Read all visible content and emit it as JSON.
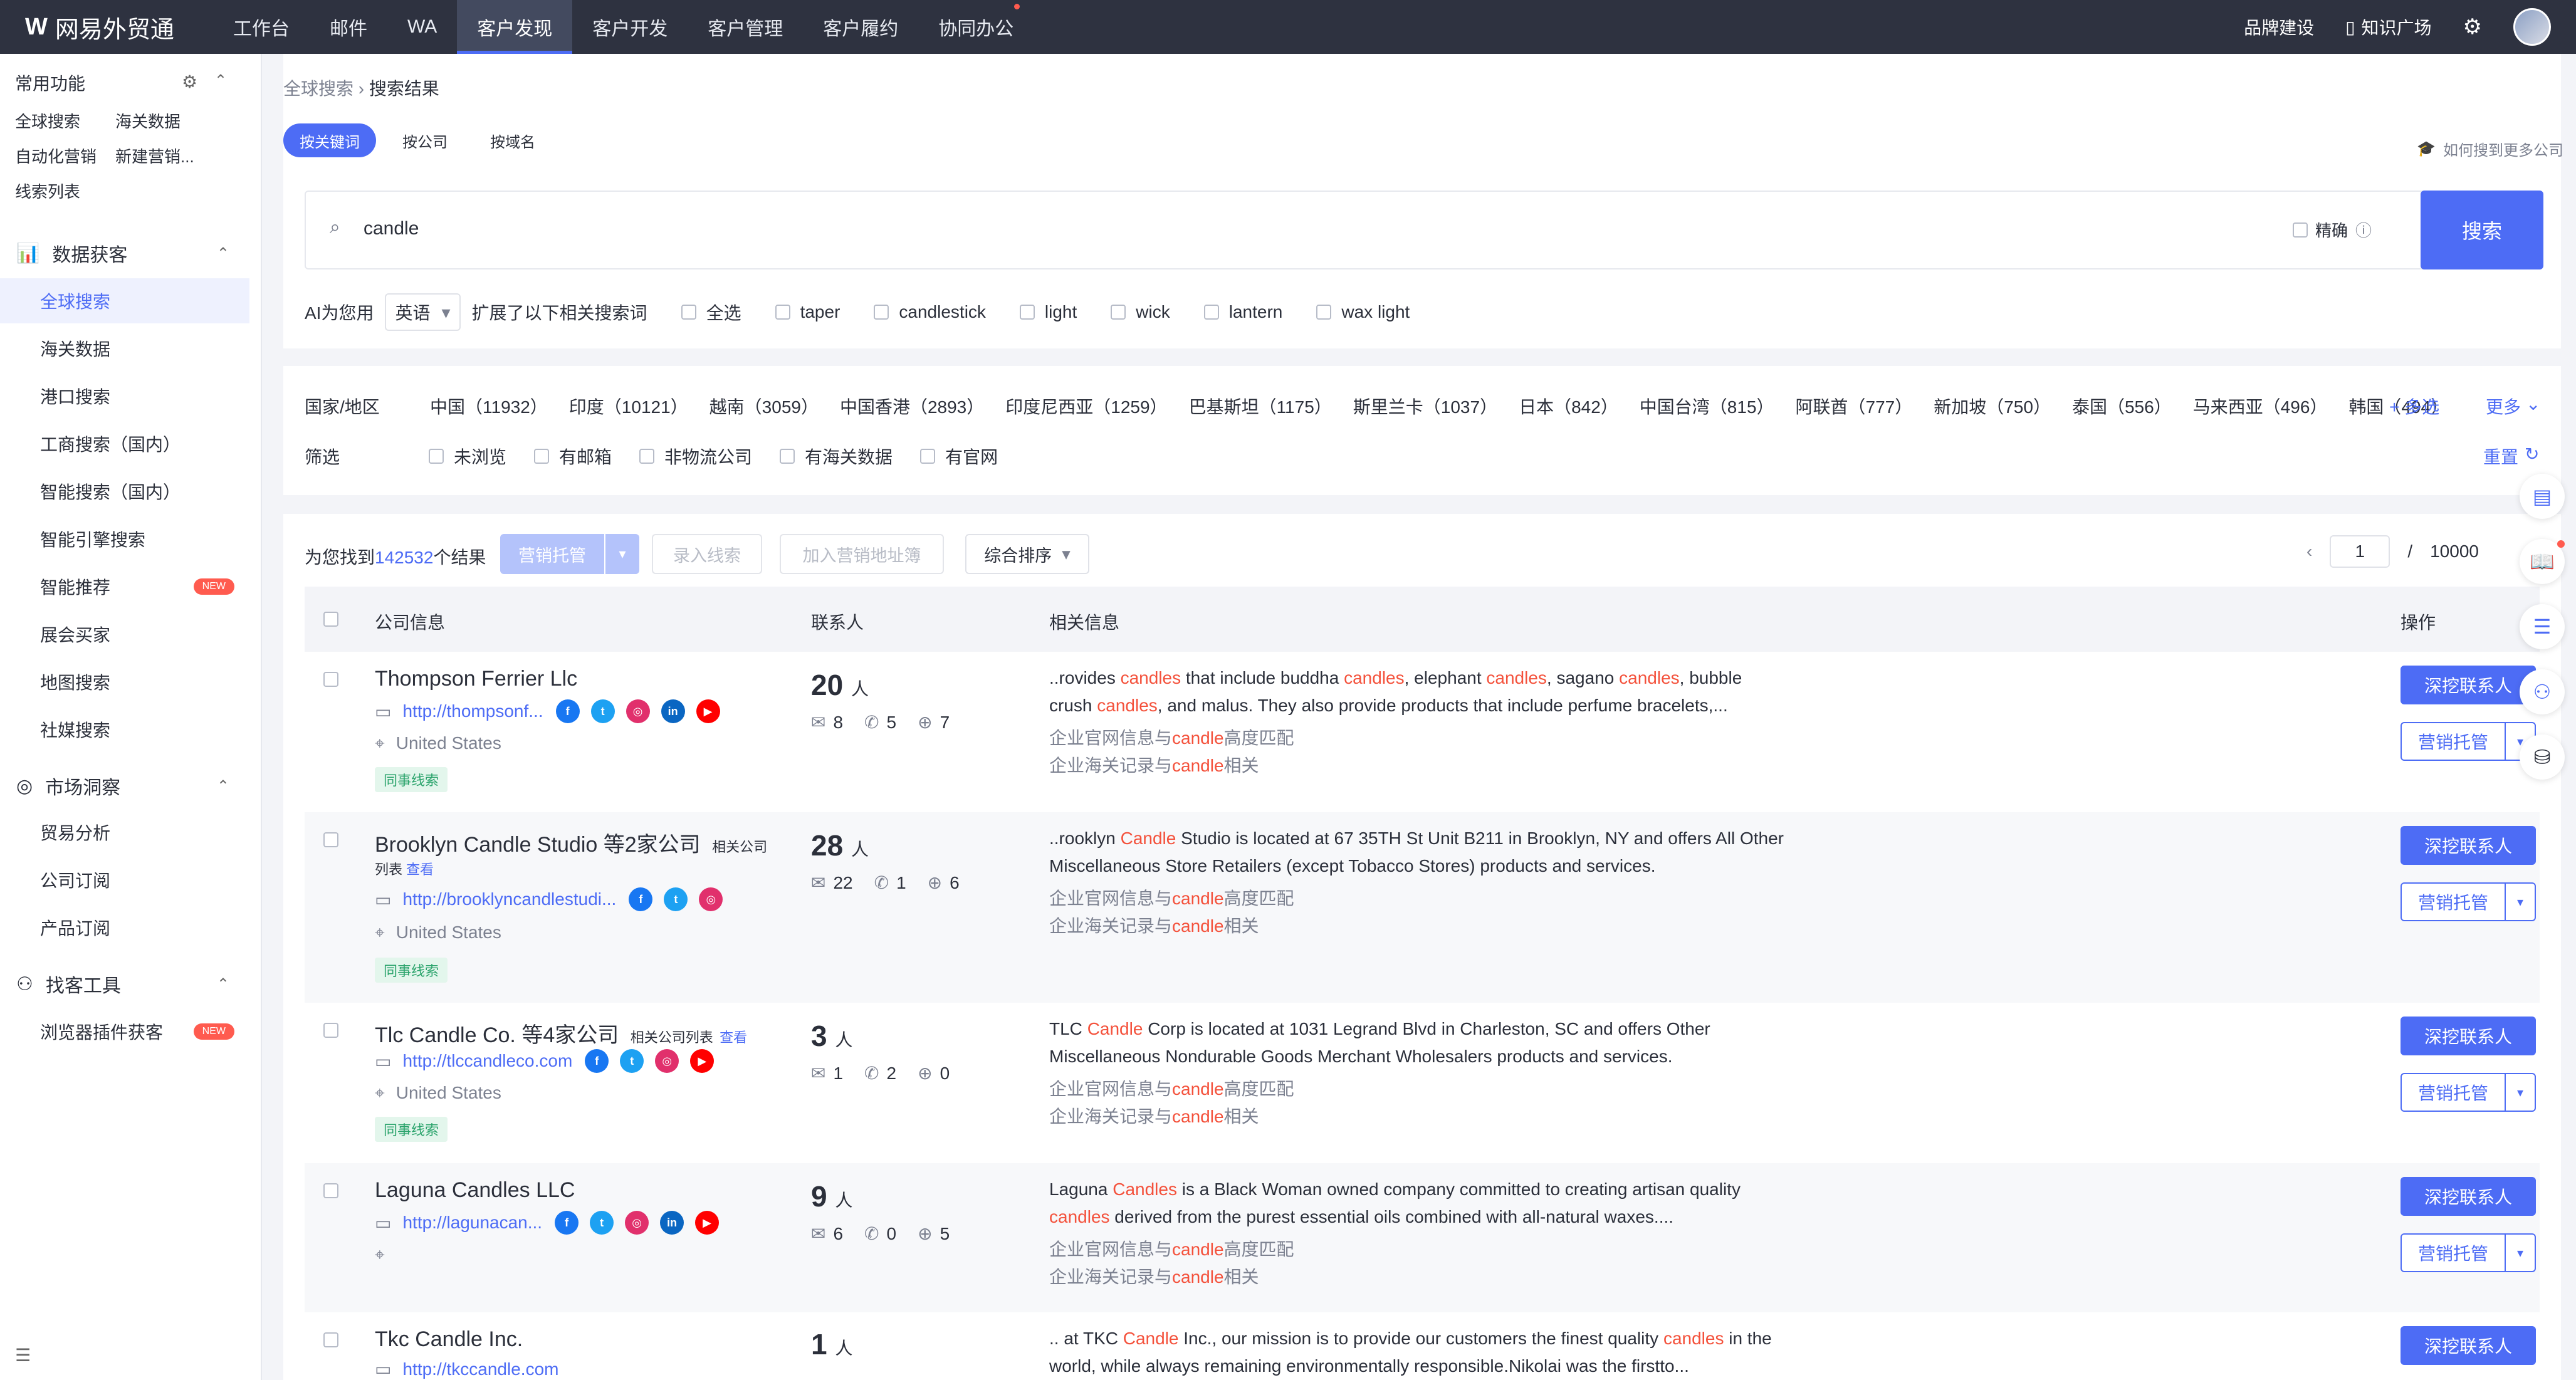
{
  "app": {
    "logo_mark": "W",
    "name": "网易外贸通"
  },
  "topnav": [
    "工作台",
    "邮件",
    "WA",
    "客户发现",
    "客户开发",
    "客户管理",
    "客户履约",
    "协同办公"
  ],
  "topright": {
    "brand": "品牌建设",
    "knowledge": "知识广场"
  },
  "sidebar": {
    "common_title": "常用功能",
    "common_links": [
      "全球搜索",
      "海关数据",
      "自动化营销",
      "新建营销...",
      "线索列表"
    ],
    "section_data": "数据获客",
    "data_items": [
      "全球搜索",
      "海关数据",
      "港口搜索",
      "工商搜索（国内）",
      "智能搜索（国内）",
      "智能引擎搜索",
      "智能推荐",
      "展会买家",
      "地图搜索",
      "社媒搜索"
    ],
    "section_market": "市场洞察",
    "market_items": [
      "贸易分析",
      "公司订阅",
      "产品订阅"
    ],
    "section_tools": "找客工具",
    "tool_items": [
      "浏览器插件获客"
    ],
    "new_badge": "NEW"
  },
  "breadcrumb": {
    "root": "全球搜索",
    "current": "搜索结果"
  },
  "search_tabs": [
    "按关键词",
    "按公司",
    "按域名"
  ],
  "help_link": "如何搜到更多公司",
  "search": {
    "value": "candle",
    "exact_label": "精确",
    "button": "搜索"
  },
  "ai": {
    "prefix": "AI为您用",
    "language": "英语",
    "suffix": "扩展了以下相关搜索词",
    "select_all": "全选",
    "terms": [
      "taper",
      "candlestick",
      "light",
      "wick",
      "lantern",
      "wax light"
    ]
  },
  "filters": {
    "country_label": "国家/地区",
    "countries": [
      "中国（11932）",
      "印度（10121）",
      "越南（3059）",
      "中国香港（2893）",
      "印度尼西亚（1259）",
      "巴基斯坦（1175）",
      "斯里兰卡（1037）",
      "日本（842）",
      "中国台湾（815）",
      "阿联酋（777）",
      "新加坡（750）",
      "泰国（556）",
      "马来西亚（496）",
      "韩国（494）"
    ],
    "multi": "+ 多选",
    "more": "更多",
    "filter_label": "筛选",
    "filter_opts": [
      "未浏览",
      "有邮箱",
      "非物流公司",
      "有海关数据",
      "有官网"
    ],
    "reset": "重置"
  },
  "results": {
    "found_prefix": "为您找到",
    "count": "142532",
    "found_suffix": "个结果",
    "btn_marketing": "营销托管",
    "btn_lead": "录入线索",
    "btn_address": "加入营销地址簿",
    "sort": "综合排序",
    "page": "1",
    "page_sep": "/",
    "total_pages": "10000"
  },
  "table_headers": {
    "company": "公司信息",
    "contacts": "联系人",
    "info": "相关信息",
    "action": "操作"
  },
  "actions": {
    "deep": "深挖联系人",
    "market": "营销托管"
  },
  "rows": [
    {
      "name": "Thompson Ferrier Llc",
      "related": "",
      "related_2": "",
      "related_link": "",
      "url": "http://thompsonf...",
      "country": "United States",
      "tag": "同事线索",
      "people": "20",
      "unit": "人",
      "mail": "8",
      "wa": "5",
      "web": "7",
      "desc": [
        {
          "t": "..rovides ",
          "h": false
        },
        {
          "t": "candles",
          "h": true
        },
        {
          "t": " that include buddha ",
          "h": false
        },
        {
          "t": "candles",
          "h": true
        },
        {
          "t": ", elephant ",
          "h": false
        },
        {
          "t": "candles",
          "h": true
        },
        {
          "t": ", sagano ",
          "h": false
        },
        {
          "t": "candles",
          "h": true
        },
        {
          "t": ", bubble crush ",
          "h": false
        },
        {
          "t": "candles",
          "h": true
        },
        {
          "t": ", and malus. They also provide products that include perfume bracelets,...",
          "h": false
        }
      ],
      "m1": [
        "企业官网信息与",
        "candle",
        "高度匹配"
      ],
      "m2": [
        "企业海关记录与",
        "candle",
        "相关"
      ]
    },
    {
      "name": "Brooklyn Candle Studio 等2家公司",
      "related": "相关公司",
      "related_2": "列表",
      "related_link": "查看",
      "url": "http://brooklyncandlestudi...",
      "country": "United States",
      "tag": "同事线索",
      "people": "28",
      "unit": "人",
      "mail": "22",
      "wa": "1",
      "web": "6",
      "desc": [
        {
          "t": "..rooklyn ",
          "h": false
        },
        {
          "t": "Candle",
          "h": true
        },
        {
          "t": " Studio is located at 67 35TH St Unit B211 in Brooklyn, NY and offers All Other Miscellaneous Store Retailers (except Tobacco Stores) products and services.",
          "h": false
        }
      ],
      "m1": [
        "企业官网信息与",
        "candle",
        "高度匹配"
      ],
      "m2": [
        "企业海关记录与",
        "candle",
        "相关"
      ]
    },
    {
      "name": "Tlc Candle Co. 等4家公司",
      "related": "相关公司列表",
      "related_2": "",
      "related_link": "查看",
      "url": "http://tlccandleco.com",
      "country": "United States",
      "tag": "同事线索",
      "people": "3",
      "unit": "人",
      "mail": "1",
      "wa": "2",
      "web": "0",
      "desc": [
        {
          "t": "TLC ",
          "h": false
        },
        {
          "t": "Candle",
          "h": true
        },
        {
          "t": " Corp is located at 1031 Legrand Blvd in Charleston, SC and offers Other Miscellaneous Nondurable Goods Merchant Wholesalers products and services.",
          "h": false
        }
      ],
      "m1": [
        "企业官网信息与",
        "candle",
        "高度匹配"
      ],
      "m2": [
        "企业海关记录与",
        "candle",
        "相关"
      ]
    },
    {
      "name": "Laguna Candles LLC",
      "related": "",
      "related_2": "",
      "related_link": "",
      "url": "http://lagunacan...",
      "country": "",
      "tag": "",
      "people": "9",
      "unit": "人",
      "mail": "6",
      "wa": "0",
      "web": "5",
      "desc": [
        {
          "t": "Laguna ",
          "h": false
        },
        {
          "t": "Candles",
          "h": true
        },
        {
          "t": " is a Black Woman owned company committed to creating artisan quality ",
          "h": false
        },
        {
          "t": "candles",
          "h": true
        },
        {
          "t": " derived from the purest essential oils combined with all-natural waxes....",
          "h": false
        }
      ],
      "m1": [
        "企业官网信息与",
        "candle",
        "高度匹配"
      ],
      "m2": [
        "企业海关记录与",
        "candle",
        "相关"
      ]
    },
    {
      "name": "Tkc Candle Inc.",
      "related": "",
      "related_2": "",
      "related_link": "",
      "url": "http://tkccandle.com",
      "country": "",
      "tag": "",
      "people": "1",
      "unit": "人",
      "mail": "",
      "wa": "",
      "web": "",
      "desc": [
        {
          "t": ".. at TKC ",
          "h": false
        },
        {
          "t": "Candle",
          "h": true
        },
        {
          "t": " Inc., our mission is to provide our customers the finest quality ",
          "h": false
        },
        {
          "t": "candles",
          "h": true
        },
        {
          "t": " in the world, while always remaining environmentally responsible.Nikolai was the firstto...",
          "h": false
        }
      ],
      "m1": [
        "",
        "",
        ""
      ],
      "m2": [
        "",
        "",
        ""
      ]
    }
  ],
  "colors": {
    "primary": "#4d6cf5",
    "highlight": "#f4513b",
    "topbar": "#2e3240"
  },
  "icons": [
    "search-icon",
    "gear-icon",
    "chevron-up-icon",
    "question-icon",
    "mail-icon",
    "whatsapp-icon",
    "globe-icon",
    "location-icon",
    "website-icon",
    "facebook-icon",
    "twitter-icon",
    "instagram-icon",
    "linkedin-icon",
    "youtube-icon",
    "reset-icon"
  ]
}
